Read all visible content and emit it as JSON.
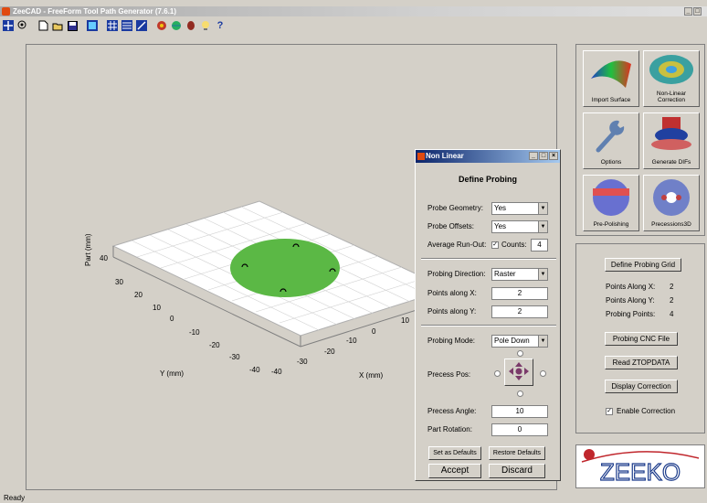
{
  "window": {
    "title": "ZeeCAD - FreeForm Tool Path Generator (7.6.1)"
  },
  "toolbar": {
    "icons": [
      "crosshair-icon",
      "zoom-icon",
      "new-file-icon",
      "open-folder-icon",
      "save-icon",
      "chart-icon",
      "grid-icon",
      "table-icon",
      "measure-icon",
      "settings-icon",
      "globe-icon",
      "bug-icon",
      "lightbulb-icon",
      "help-icon"
    ],
    "help_label": "?"
  },
  "plot": {
    "zlabel": "Part (mm)",
    "ylabel": "Y (mm)",
    "xlabel": "X (mm)",
    "z_ticks": [
      "40"
    ],
    "y_ticks": [
      "30",
      "20",
      "10",
      "0",
      "-10",
      "-20",
      "-30",
      "-40"
    ],
    "x_ticks": [
      "10",
      "0",
      "-10",
      "-20",
      "-30",
      "-40"
    ],
    "colors": {
      "part": "#5bb845",
      "grid": "#c8c8c8",
      "axes_bg": "#ffffff"
    }
  },
  "tools": {
    "import_surface": "Import Surface",
    "nonlinear": "Non-Linear Correction",
    "options": "Options",
    "generate_difs": "Generate DIFs",
    "pre_polishing": "Pre-Polishing",
    "precessions3d": "Precessions3D"
  },
  "probe_panel": {
    "define_grid": "Define Probing Grid",
    "points_x_label": "Points Along X:",
    "points_x_value": "2",
    "points_y_label": "Points Along Y:",
    "points_y_value": "2",
    "probing_points_label": "Probing Points:",
    "probing_points_value": "4",
    "cnc_file": "Probing CNC File",
    "read_ztop": "Read ZTOPDATA",
    "display_correction": "Display Correction",
    "enable_correction": "Enable Correction",
    "enable_checked": true
  },
  "logo": {
    "text": "ZEEKO",
    "colors": {
      "accent": "#c0262c",
      "text": "#1a3a8a"
    }
  },
  "status": {
    "text": "Ready"
  },
  "dialog": {
    "title": "Non Linear",
    "heading": "Define Probing",
    "probe_geometry_label": "Probe Geometry:",
    "probe_geometry_value": "Yes",
    "probe_offsets_label": "Probe Offsets:",
    "probe_offsets_value": "Yes",
    "average_runout_label": "Average Run-Out:",
    "counts_label": "Counts:",
    "counts_value": "4",
    "probing_direction_label": "Probing Direction:",
    "probing_direction_value": "Raster",
    "points_x_label": "Points along X:",
    "points_x_value": "2",
    "points_y_label": "Points along Y:",
    "points_y_value": "2",
    "probing_mode_label": "Probing Mode:",
    "probing_mode_value": "Pole Down",
    "precess_pos_label": "Precess Pos:",
    "precess_angle_label": "Precess Angle:",
    "precess_angle_value": "10",
    "part_rotation_label": "Part Rotation:",
    "part_rotation_value": "0",
    "set_defaults": "Set as Defaults",
    "restore_defaults": "Restore Defaults",
    "accept": "Accept",
    "discard": "Discard"
  }
}
